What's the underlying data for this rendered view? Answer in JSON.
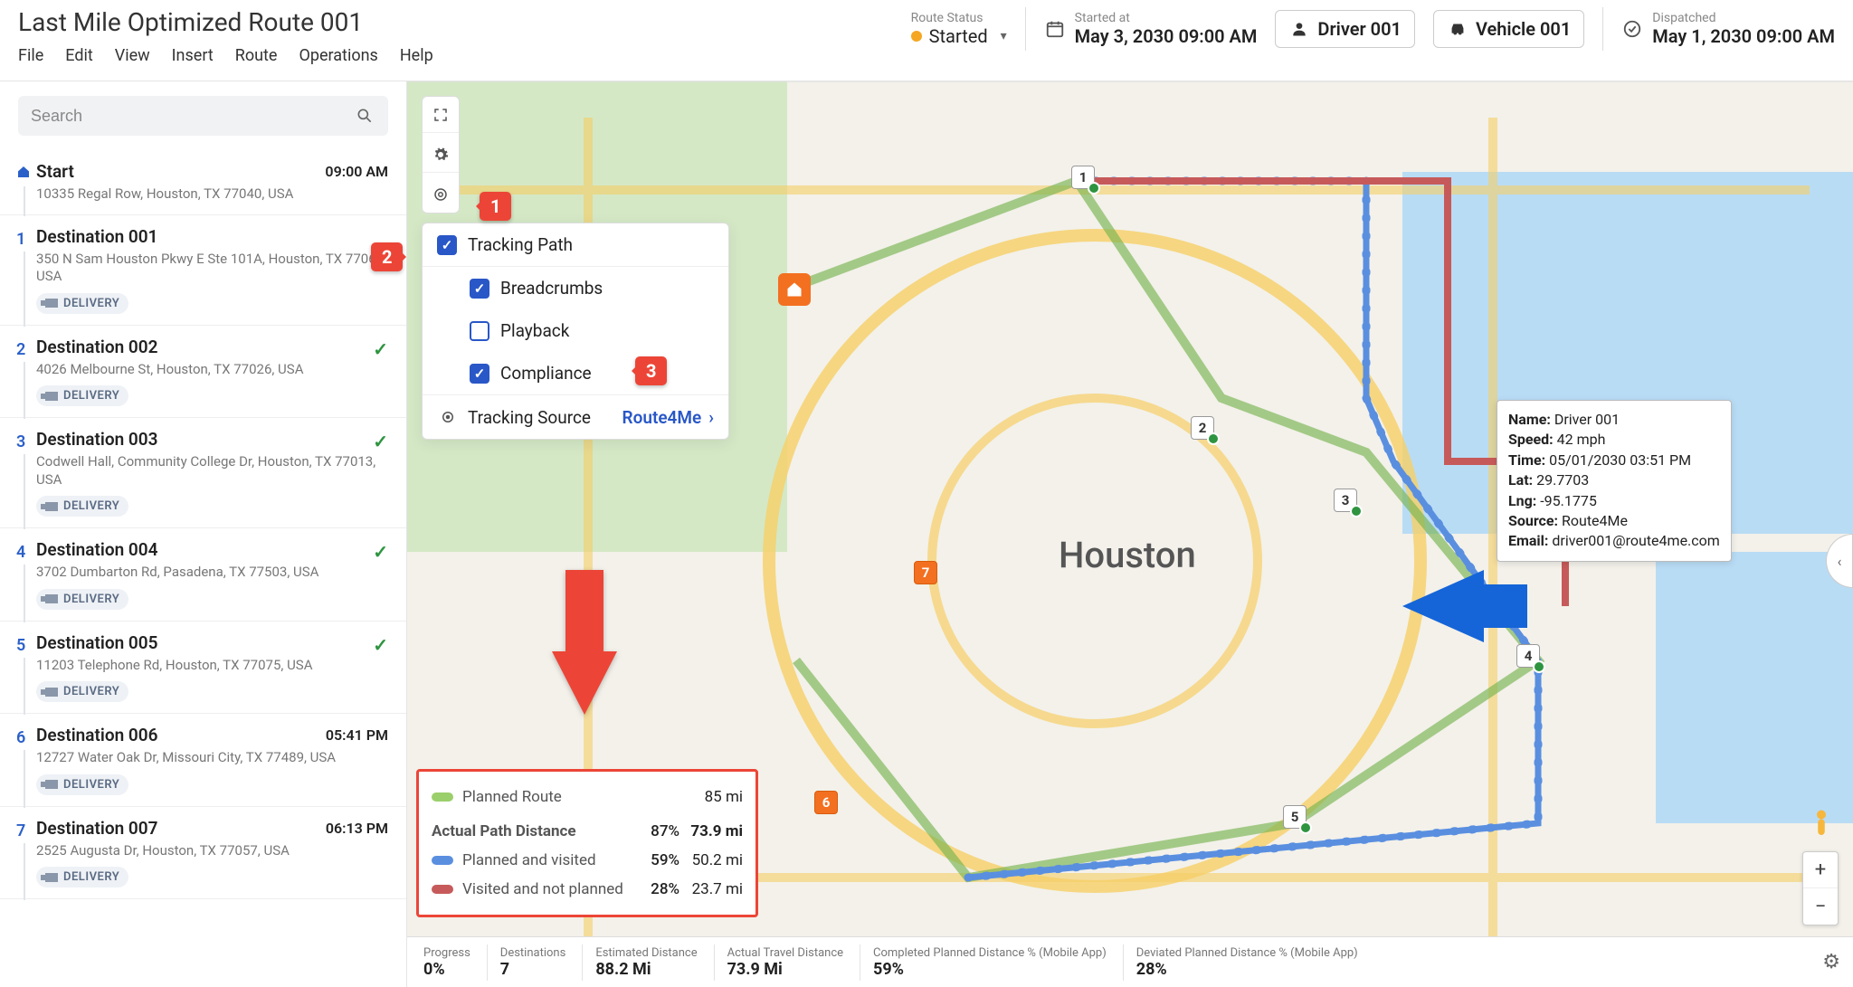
{
  "title": "Last Mile Optimized Route 001",
  "menubar": [
    "File",
    "Edit",
    "View",
    "Insert",
    "Route",
    "Operations",
    "Help"
  ],
  "route_status": {
    "label": "Route Status",
    "value": "Started"
  },
  "started_at": {
    "label": "Started at",
    "value": "May 3, 2030 09:00 AM"
  },
  "driver_chip": "Driver 001",
  "vehicle_chip": "Vehicle 001",
  "dispatched": {
    "label": "Dispatched",
    "value": "May 1, 2030 09:00 AM"
  },
  "sidebar": {
    "search_placeholder": "Search",
    "stops": [
      {
        "n": "home",
        "title": "Start",
        "addr": "10335 Regal Row, Houston, TX 77040, USA",
        "time": "09:00 AM",
        "done": false,
        "badge": ""
      },
      {
        "n": "1",
        "title": "Destination 001",
        "addr": "350 N Sam Houston Pkwy E Ste 101A, Houston, TX 77060, USA",
        "time": "",
        "done": false,
        "badge": "DELIVERY"
      },
      {
        "n": "2",
        "title": "Destination 002",
        "addr": "4026 Melbourne St, Houston, TX 77026, USA",
        "time": "",
        "done": true,
        "badge": "DELIVERY"
      },
      {
        "n": "3",
        "title": "Destination 003",
        "addr": "Codwell Hall, Community College Dr, Houston, TX 77013, USA",
        "time": "",
        "done": true,
        "badge": "DELIVERY"
      },
      {
        "n": "4",
        "title": "Destination 004",
        "addr": "3702 Dumbarton Rd, Pasadena, TX 77503, USA",
        "time": "",
        "done": true,
        "badge": "DELIVERY"
      },
      {
        "n": "5",
        "title": "Destination 005",
        "addr": "11203 Telephone Rd, Houston, TX 77075, USA",
        "time": "",
        "done": true,
        "badge": "DELIVERY"
      },
      {
        "n": "6",
        "title": "Destination 006",
        "addr": "12727 Water Oak Dr, Missouri City, TX 77489, USA",
        "time": "05:41 PM",
        "done": false,
        "badge": "DELIVERY"
      },
      {
        "n": "7",
        "title": "Destination 007",
        "addr": "2525 Augusta Dr, Houston, TX 77057, USA",
        "time": "06:13 PM",
        "done": false,
        "badge": "DELIVERY"
      }
    ]
  },
  "popover": {
    "tracking_path": {
      "label": "Tracking Path",
      "checked": true
    },
    "breadcrumbs": {
      "label": "Breadcrumbs",
      "checked": true
    },
    "playback": {
      "label": "Playback",
      "checked": false
    },
    "compliance": {
      "label": "Compliance",
      "checked": true
    },
    "tracking_src_label": "Tracking Source",
    "tracking_src_value": "Route4Me"
  },
  "annot": {
    "a1": "1",
    "a2": "2",
    "a3": "3"
  },
  "legend": {
    "planned_route": {
      "label": "Planned Route",
      "mi": "85 mi"
    },
    "hdr_label": "Actual Path Distance",
    "hdr_pct": "87%",
    "hdr_mi": "73.9 mi",
    "planned_and_visited": {
      "label": "Planned and visited",
      "pct": "59%",
      "mi": "50.2 mi"
    },
    "visited_not_planned": {
      "label": "Visited and not planned",
      "pct": "28%",
      "mi": "23.7 mi"
    }
  },
  "map_center_label": "Houston",
  "driver_tooltip": {
    "name_l": "Name:",
    "name_v": "Driver 001",
    "speed_l": "Speed:",
    "speed_v": "42 mph",
    "time_l": "Time:",
    "time_v": "05/01/2030 03:51 PM",
    "lat_l": "Lat:",
    "lat_v": "29.7703",
    "lng_l": "Lng:",
    "lng_v": "-95.1775",
    "src_l": "Source:",
    "src_v": "Route4Me",
    "email_l": "Email:",
    "email_v": "driver001@route4me.com"
  },
  "status_bar": {
    "progress": {
      "l": "Progress",
      "v": "0%"
    },
    "dest": {
      "l": "Destinations",
      "v": "7"
    },
    "est_dist": {
      "l": "Estimated Distance",
      "v": "88.2 Mi"
    },
    "act_dist": {
      "l": "Actual Travel Distance",
      "v": "73.9 Mi"
    },
    "comp_pct": {
      "l": "Completed Planned Distance % (Mobile App)",
      "v": "59%"
    },
    "dev_pct": {
      "l": "Deviated Planned Distance % (Mobile App)",
      "v": "28%"
    }
  },
  "markers": {
    "m1": "1",
    "m2": "2",
    "m3": "3",
    "m4": "4",
    "m5": "5",
    "m6": "6",
    "m7": "7"
  }
}
